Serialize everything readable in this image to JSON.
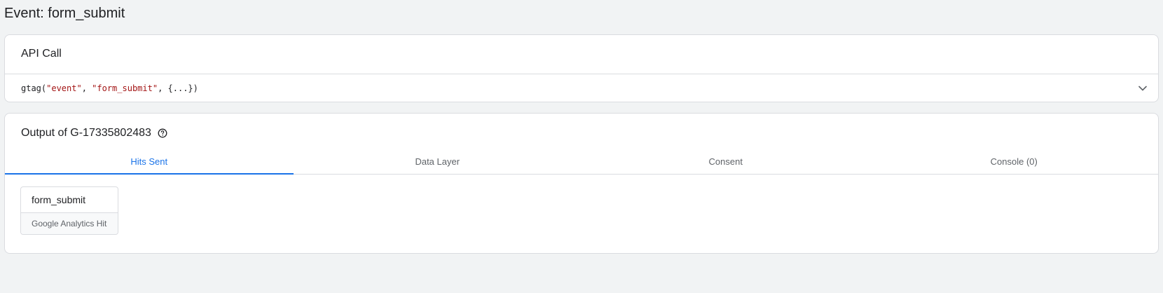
{
  "page": {
    "title": "Event: form_submit"
  },
  "api_call": {
    "title": "API Call",
    "code": {
      "fn_open": "gtag(",
      "arg1": "\"event\"",
      "sep1": ", ",
      "arg2": "\"form_submit\"",
      "rest": ", {...})"
    },
    "expand_icon": "chevron-down-icon"
  },
  "output": {
    "title": "Output of G-17335802483",
    "help_icon": "help-circle-icon",
    "tabs": [
      {
        "label": "Hits Sent",
        "active": true
      },
      {
        "label": "Data Layer",
        "active": false
      },
      {
        "label": "Consent",
        "active": false
      },
      {
        "label": "Console (0)",
        "active": false
      }
    ],
    "hits": [
      {
        "name": "form_submit",
        "type": "Google Analytics Hit"
      }
    ]
  },
  "colors": {
    "background": "#f1f3f4",
    "accent": "#1a73e8",
    "code_string": "#a31515",
    "border": "#dadce0",
    "secondary_text": "#5f6368"
  }
}
